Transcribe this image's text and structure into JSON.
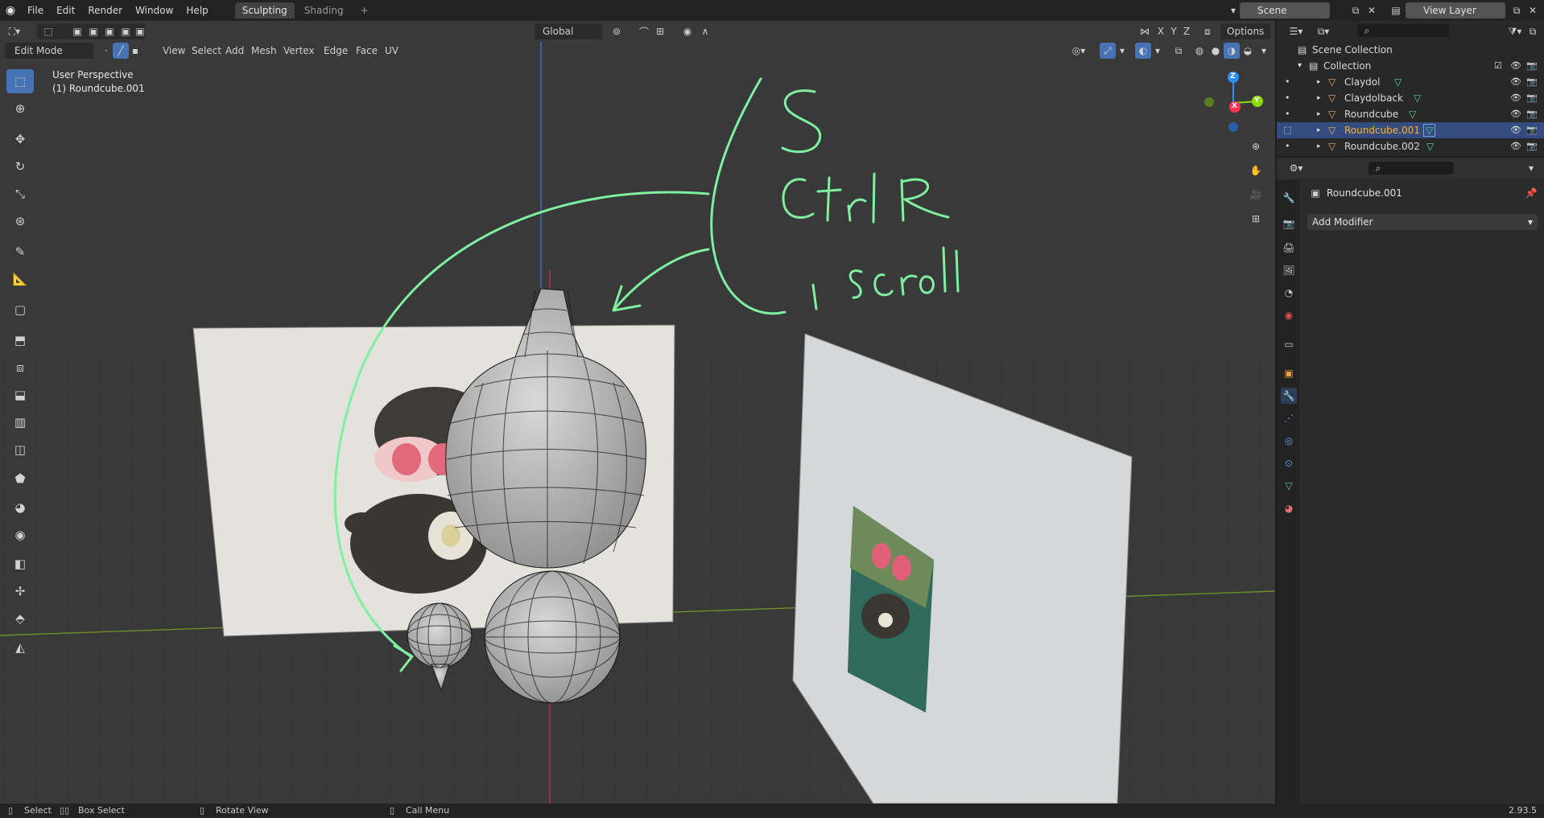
{
  "topbar": {
    "menus": [
      "File",
      "Edit",
      "Render",
      "Window",
      "Help"
    ],
    "tabs": [
      "Sculpting",
      "Shading"
    ],
    "add_tab": "+",
    "scene_label": "Scene",
    "view_layer_label": "View Layer"
  },
  "viewport_header": {
    "mode": "Edit Mode",
    "menus": [
      "View",
      "Select",
      "Add",
      "Mesh",
      "Vertex",
      "Edge",
      "Face",
      "UV"
    ],
    "orientation": "Global",
    "axes": [
      "X",
      "Y",
      "Z"
    ],
    "options": "Options"
  },
  "viewport": {
    "perspective_label": "User Perspective",
    "object_label": "(1) Roundcube.001",
    "annotations": [
      "S",
      "Ctrl R",
      "1 scroll"
    ],
    "gizmo_axes": {
      "x": "X",
      "y": "Y",
      "z": "Z"
    }
  },
  "toolbar": {
    "tools": [
      "select-box",
      "cursor",
      "move",
      "rotate",
      "scale",
      "transform",
      "annotate",
      "measure",
      "add-cube",
      "extrude",
      "inset",
      "bevel",
      "loop-cut",
      "knife",
      "poly-build",
      "spin",
      "smooth",
      "edge-slide",
      "shrink-fatten",
      "shear",
      "rip-region"
    ],
    "active": "select-box"
  },
  "outliner": {
    "root": "Scene Collection",
    "collection": "Collection",
    "objects": [
      {
        "name": "Claydol",
        "selected": false
      },
      {
        "name": "Claydolback",
        "selected": false
      },
      {
        "name": "Roundcube",
        "selected": false
      },
      {
        "name": "Roundcube.001",
        "selected": true
      },
      {
        "name": "Roundcube.002",
        "selected": false
      }
    ]
  },
  "properties": {
    "object_name": "Roundcube.001",
    "add_modifier": "Add Modifier"
  },
  "statusbar": {
    "items": [
      "Select",
      "Box Select",
      "Rotate View",
      "Call Menu"
    ],
    "version": "2.93.5"
  },
  "colors": {
    "accent": "#4772b3",
    "selected_text": "#ffaf29",
    "annotation": "#7ef0a0",
    "axis_x": "#ff3352",
    "axis_y": "#8bdc00",
    "axis_z": "#2890ff"
  }
}
